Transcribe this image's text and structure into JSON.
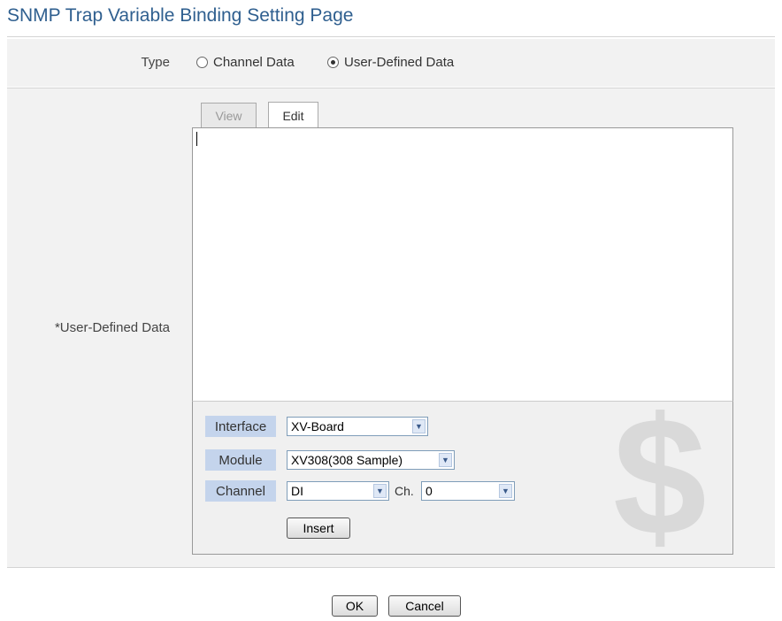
{
  "page_title": "SNMP Trap Variable Binding Setting Page",
  "type_row": {
    "label": "Type",
    "options": [
      {
        "label": "Channel Data",
        "selected": false
      },
      {
        "label": "User-Defined Data",
        "selected": true
      }
    ]
  },
  "user_defined": {
    "label": "*User-Defined Data",
    "tabs": [
      "View",
      "Edit"
    ],
    "active_tab": "Edit",
    "editor_value": ""
  },
  "toolbox": {
    "interface_label": "Interface",
    "interface_value": "XV-Board",
    "module_label": "Module",
    "module_value": "XV308(308 Sample)",
    "channel_label": "Channel",
    "channel_value": "DI",
    "ch_label": "Ch.",
    "ch_value": "0",
    "insert_label": "Insert"
  },
  "footer": {
    "ok_label": "OK",
    "cancel_label": "Cancel"
  }
}
